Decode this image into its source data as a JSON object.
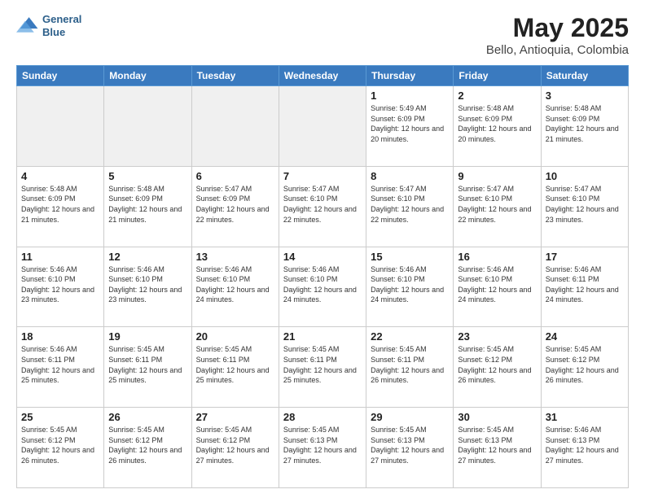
{
  "header": {
    "logo_line1": "General",
    "logo_line2": "Blue",
    "title": "May 2025",
    "subtitle": "Bello, Antioquia, Colombia"
  },
  "days_of_week": [
    "Sunday",
    "Monday",
    "Tuesday",
    "Wednesday",
    "Thursday",
    "Friday",
    "Saturday"
  ],
  "weeks": [
    [
      {
        "day": "",
        "empty": true
      },
      {
        "day": "",
        "empty": true
      },
      {
        "day": "",
        "empty": true
      },
      {
        "day": "",
        "empty": true
      },
      {
        "day": "1",
        "sunrise": "Sunrise: 5:49 AM",
        "sunset": "Sunset: 6:09 PM",
        "daylight": "Daylight: 12 hours and 20 minutes."
      },
      {
        "day": "2",
        "sunrise": "Sunrise: 5:48 AM",
        "sunset": "Sunset: 6:09 PM",
        "daylight": "Daylight: 12 hours and 20 minutes."
      },
      {
        "day": "3",
        "sunrise": "Sunrise: 5:48 AM",
        "sunset": "Sunset: 6:09 PM",
        "daylight": "Daylight: 12 hours and 21 minutes."
      }
    ],
    [
      {
        "day": "4",
        "sunrise": "Sunrise: 5:48 AM",
        "sunset": "Sunset: 6:09 PM",
        "daylight": "Daylight: 12 hours and 21 minutes."
      },
      {
        "day": "5",
        "sunrise": "Sunrise: 5:48 AM",
        "sunset": "Sunset: 6:09 PM",
        "daylight": "Daylight: 12 hours and 21 minutes."
      },
      {
        "day": "6",
        "sunrise": "Sunrise: 5:47 AM",
        "sunset": "Sunset: 6:09 PM",
        "daylight": "Daylight: 12 hours and 22 minutes."
      },
      {
        "day": "7",
        "sunrise": "Sunrise: 5:47 AM",
        "sunset": "Sunset: 6:10 PM",
        "daylight": "Daylight: 12 hours and 22 minutes."
      },
      {
        "day": "8",
        "sunrise": "Sunrise: 5:47 AM",
        "sunset": "Sunset: 6:10 PM",
        "daylight": "Daylight: 12 hours and 22 minutes."
      },
      {
        "day": "9",
        "sunrise": "Sunrise: 5:47 AM",
        "sunset": "Sunset: 6:10 PM",
        "daylight": "Daylight: 12 hours and 22 minutes."
      },
      {
        "day": "10",
        "sunrise": "Sunrise: 5:47 AM",
        "sunset": "Sunset: 6:10 PM",
        "daylight": "Daylight: 12 hours and 23 minutes."
      }
    ],
    [
      {
        "day": "11",
        "sunrise": "Sunrise: 5:46 AM",
        "sunset": "Sunset: 6:10 PM",
        "daylight": "Daylight: 12 hours and 23 minutes."
      },
      {
        "day": "12",
        "sunrise": "Sunrise: 5:46 AM",
        "sunset": "Sunset: 6:10 PM",
        "daylight": "Daylight: 12 hours and 23 minutes."
      },
      {
        "day": "13",
        "sunrise": "Sunrise: 5:46 AM",
        "sunset": "Sunset: 6:10 PM",
        "daylight": "Daylight: 12 hours and 24 minutes."
      },
      {
        "day": "14",
        "sunrise": "Sunrise: 5:46 AM",
        "sunset": "Sunset: 6:10 PM",
        "daylight": "Daylight: 12 hours and 24 minutes."
      },
      {
        "day": "15",
        "sunrise": "Sunrise: 5:46 AM",
        "sunset": "Sunset: 6:10 PM",
        "daylight": "Daylight: 12 hours and 24 minutes."
      },
      {
        "day": "16",
        "sunrise": "Sunrise: 5:46 AM",
        "sunset": "Sunset: 6:10 PM",
        "daylight": "Daylight: 12 hours and 24 minutes."
      },
      {
        "day": "17",
        "sunrise": "Sunrise: 5:46 AM",
        "sunset": "Sunset: 6:11 PM",
        "daylight": "Daylight: 12 hours and 24 minutes."
      }
    ],
    [
      {
        "day": "18",
        "sunrise": "Sunrise: 5:46 AM",
        "sunset": "Sunset: 6:11 PM",
        "daylight": "Daylight: 12 hours and 25 minutes."
      },
      {
        "day": "19",
        "sunrise": "Sunrise: 5:45 AM",
        "sunset": "Sunset: 6:11 PM",
        "daylight": "Daylight: 12 hours and 25 minutes."
      },
      {
        "day": "20",
        "sunrise": "Sunrise: 5:45 AM",
        "sunset": "Sunset: 6:11 PM",
        "daylight": "Daylight: 12 hours and 25 minutes."
      },
      {
        "day": "21",
        "sunrise": "Sunrise: 5:45 AM",
        "sunset": "Sunset: 6:11 PM",
        "daylight": "Daylight: 12 hours and 25 minutes."
      },
      {
        "day": "22",
        "sunrise": "Sunrise: 5:45 AM",
        "sunset": "Sunset: 6:11 PM",
        "daylight": "Daylight: 12 hours and 26 minutes."
      },
      {
        "day": "23",
        "sunrise": "Sunrise: 5:45 AM",
        "sunset": "Sunset: 6:12 PM",
        "daylight": "Daylight: 12 hours and 26 minutes."
      },
      {
        "day": "24",
        "sunrise": "Sunrise: 5:45 AM",
        "sunset": "Sunset: 6:12 PM",
        "daylight": "Daylight: 12 hours and 26 minutes."
      }
    ],
    [
      {
        "day": "25",
        "sunrise": "Sunrise: 5:45 AM",
        "sunset": "Sunset: 6:12 PM",
        "daylight": "Daylight: 12 hours and 26 minutes."
      },
      {
        "day": "26",
        "sunrise": "Sunrise: 5:45 AM",
        "sunset": "Sunset: 6:12 PM",
        "daylight": "Daylight: 12 hours and 26 minutes."
      },
      {
        "day": "27",
        "sunrise": "Sunrise: 5:45 AM",
        "sunset": "Sunset: 6:12 PM",
        "daylight": "Daylight: 12 hours and 27 minutes."
      },
      {
        "day": "28",
        "sunrise": "Sunrise: 5:45 AM",
        "sunset": "Sunset: 6:13 PM",
        "daylight": "Daylight: 12 hours and 27 minutes."
      },
      {
        "day": "29",
        "sunrise": "Sunrise: 5:45 AM",
        "sunset": "Sunset: 6:13 PM",
        "daylight": "Daylight: 12 hours and 27 minutes."
      },
      {
        "day": "30",
        "sunrise": "Sunrise: 5:45 AM",
        "sunset": "Sunset: 6:13 PM",
        "daylight": "Daylight: 12 hours and 27 minutes."
      },
      {
        "day": "31",
        "sunrise": "Sunrise: 5:46 AM",
        "sunset": "Sunset: 6:13 PM",
        "daylight": "Daylight: 12 hours and 27 minutes."
      }
    ]
  ]
}
